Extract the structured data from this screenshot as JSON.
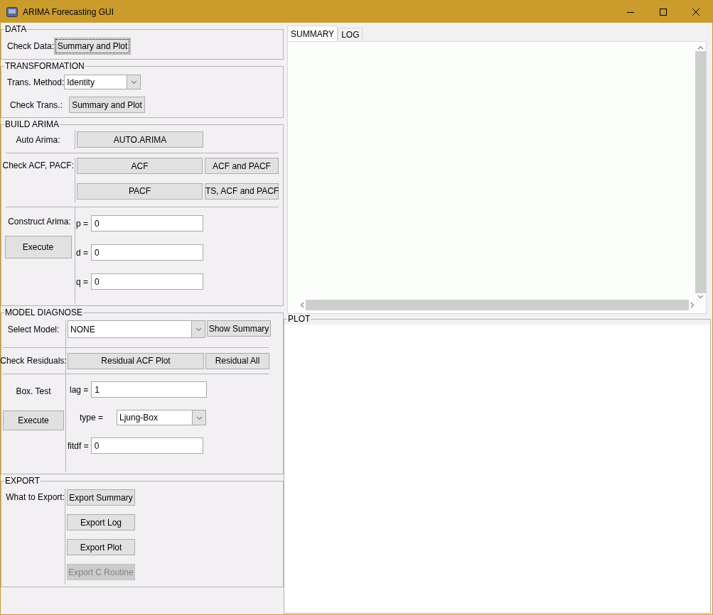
{
  "window": {
    "title": "ARIMA Forecasting GUI"
  },
  "data": {
    "title": "DATA",
    "label": "Check Data:",
    "button": {
      "label": "Summary and Plot",
      "focused": true
    }
  },
  "transformation": {
    "title": "TRANSFORMATION",
    "method_label": "Trans. Method:",
    "method_value": "Identity",
    "check_label": "Check Trans.:",
    "check_button": "Summary and Plot"
  },
  "build_arima": {
    "title": "BUILD ARIMA",
    "auto_label": "Auto Arima:",
    "auto_button": "AUTO.ARIMA",
    "acf_label": "Check ACF, PACF:",
    "acf_buttons": [
      "ACF",
      "ACF and PACF",
      "PACF",
      "TS, ACF and PACF"
    ],
    "construct_label": "Construct Arima:",
    "execute_button": "Execute",
    "params": [
      {
        "label": "p =",
        "value": "0"
      },
      {
        "label": "d =",
        "value": "0"
      },
      {
        "label": "q =",
        "value": "0"
      }
    ]
  },
  "model_diagnose": {
    "title": "MODEL DIAGNOSE",
    "select_label": "Select Model:",
    "select_value": "NONE",
    "show_summary_button": "Show Summary",
    "residual_label": "Check Residuals:",
    "residual_buttons": [
      "Residual ACF Plot",
      "Residual All"
    ],
    "box_label": "Box. Test",
    "execute_button": "Execute",
    "lag": {
      "label": "lag =",
      "value": "1"
    },
    "type": {
      "label": "type =",
      "value": "Ljung-Box"
    },
    "fitdf": {
      "label": "fitdf =",
      "value": "0"
    }
  },
  "export": {
    "title": "EXPORT",
    "label": "What to Export:",
    "buttons": [
      {
        "label": "Export Summary",
        "disabled": false
      },
      {
        "label": "Export Log",
        "disabled": false
      },
      {
        "label": "Export Plot",
        "disabled": false
      },
      {
        "label": "Export C Routine",
        "disabled": true
      }
    ]
  },
  "tabs": [
    {
      "label": "SUMMARY",
      "selected": true
    },
    {
      "label": "LOG",
      "selected": false
    }
  ],
  "plot": {
    "title": "PLOT"
  }
}
